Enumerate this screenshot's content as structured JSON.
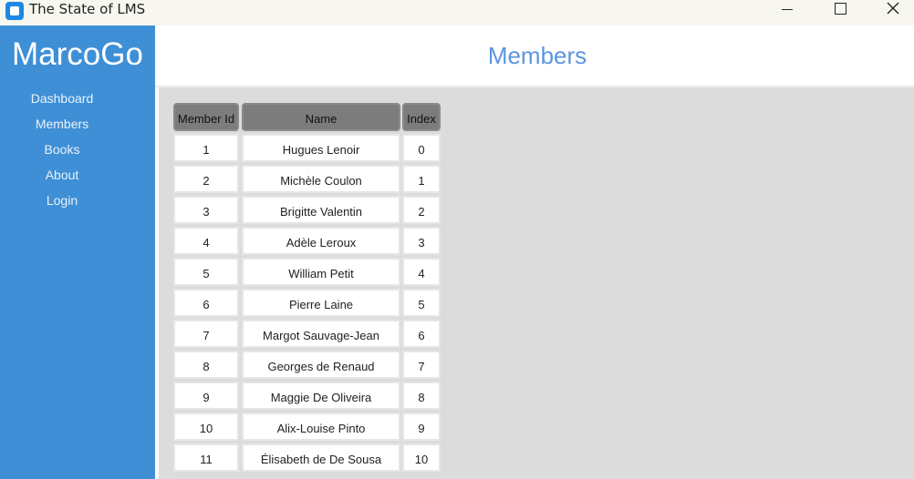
{
  "window": {
    "title": "The State of LMS"
  },
  "sidebar": {
    "brand": "MarcoGo",
    "items": [
      {
        "label": "Dashboard"
      },
      {
        "label": "Members"
      },
      {
        "label": "Books"
      },
      {
        "label": "About"
      },
      {
        "label": "Login"
      }
    ]
  },
  "header": {
    "title": "Members"
  },
  "table": {
    "columns": [
      "Member Id",
      "Name",
      "Index"
    ],
    "rows": [
      {
        "id": "1",
        "name": "Hugues Lenoir",
        "index": "0"
      },
      {
        "id": "2",
        "name": "Michèle Coulon",
        "index": "1"
      },
      {
        "id": "3",
        "name": "Brigitte Valentin",
        "index": "2"
      },
      {
        "id": "4",
        "name": "Adèle Leroux",
        "index": "3"
      },
      {
        "id": "5",
        "name": "William Petit",
        "index": "4"
      },
      {
        "id": "6",
        "name": "Pierre Laine",
        "index": "5"
      },
      {
        "id": "7",
        "name": "Margot Sauvage-Jean",
        "index": "6"
      },
      {
        "id": "8",
        "name": "Georges de Renaud",
        "index": "7"
      },
      {
        "id": "9",
        "name": "Maggie De Oliveira",
        "index": "8"
      },
      {
        "id": "10",
        "name": "Alix-Louise Pinto",
        "index": "9"
      },
      {
        "id": "11",
        "name": "Élisabeth de De Sousa",
        "index": "10"
      }
    ]
  },
  "colors": {
    "sidebar": "#3f8fd6",
    "title_accent": "#5b95e0",
    "content_bg": "#dcdcdc",
    "header_cell": "#7c7c7c"
  }
}
